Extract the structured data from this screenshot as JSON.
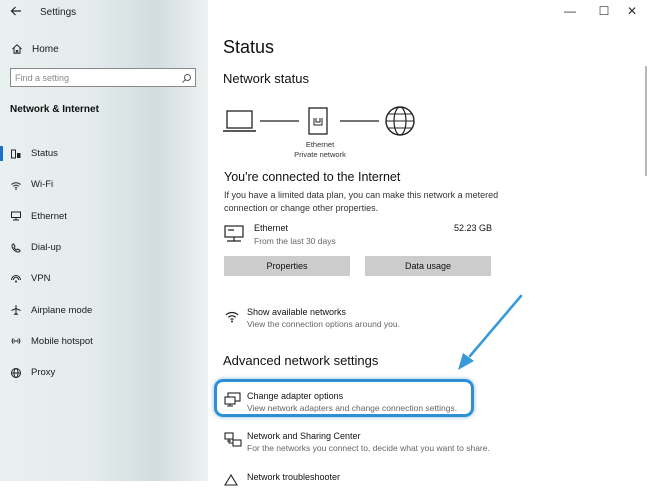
{
  "window": {
    "title": "Settings",
    "minimize_glyph": "—",
    "maximize_glyph": "☐",
    "close_glyph": "✕"
  },
  "sidebar": {
    "back_icon": "back-arrow-icon",
    "home_label": "Home",
    "search_placeholder": "Find a setting",
    "section_title": "Network & Internet",
    "items": [
      {
        "label": "Status",
        "icon": "status-icon",
        "active": true
      },
      {
        "label": "Wi-Fi",
        "icon": "wifi-icon"
      },
      {
        "label": "Ethernet",
        "icon": "ethernet-icon"
      },
      {
        "label": "Dial-up",
        "icon": "dialup-icon"
      },
      {
        "label": "VPN",
        "icon": "vpn-icon"
      },
      {
        "label": "Airplane mode",
        "icon": "airplane-icon"
      },
      {
        "label": "Mobile hotspot",
        "icon": "hotspot-icon"
      },
      {
        "label": "Proxy",
        "icon": "globe-icon"
      }
    ]
  },
  "main": {
    "page_title": "Status",
    "network_status_heading": "Network status",
    "diagram": {
      "device_label": "Ethernet",
      "network_label": "Private network"
    },
    "connected_heading": "You're connected to the Internet",
    "connected_description": "If you have a limited data plan, you can make this network a metered connection or change other properties.",
    "connection": {
      "name": "Ethernet",
      "period": "From the last 30 days",
      "usage": "52.23 GB"
    },
    "buttons": {
      "properties": "Properties",
      "data_usage": "Data usage"
    },
    "show_networks": {
      "title": "Show available networks",
      "subtitle": "View the connection options around you."
    },
    "advanced_heading": "Advanced network settings",
    "change_adapter": {
      "title": "Change adapter options",
      "subtitle": "View network adapters and change connection settings."
    },
    "sharing_center": {
      "title": "Network and Sharing Center",
      "subtitle": "For the networks you connect to, decide what you want to share."
    },
    "troubleshooter": {
      "title": "Network troubleshooter"
    }
  },
  "colors": {
    "accent": "#1a73c7",
    "highlight": "#2f8fd3",
    "button_bg": "#cccccc"
  }
}
